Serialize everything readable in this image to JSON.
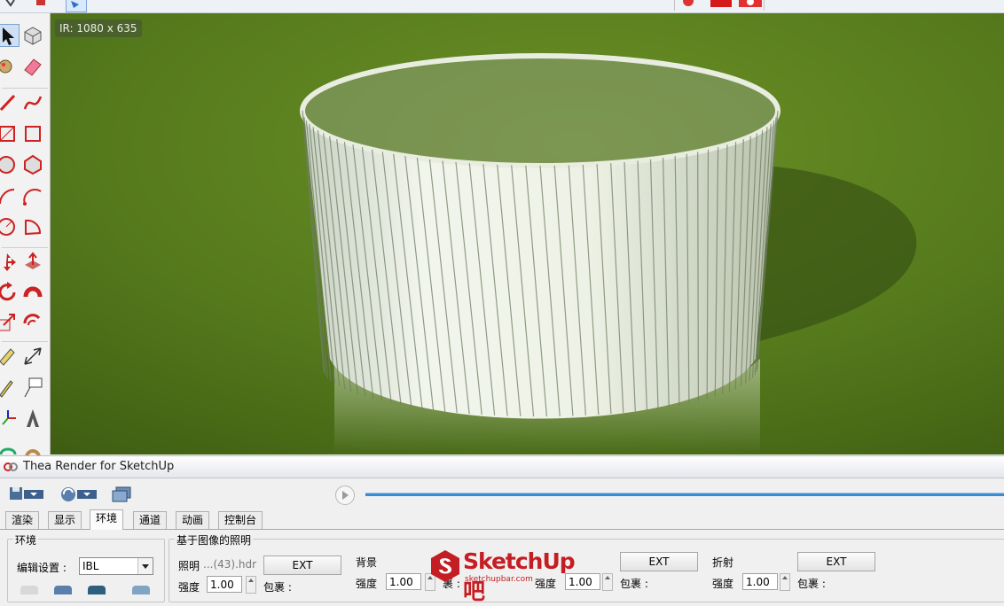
{
  "viewport": {
    "badge": "IR: 1080 x 635"
  },
  "thea": {
    "title": "Thea Render for SketchUp",
    "tabs": [
      "渲染",
      "显示",
      "环境",
      "通道",
      "动画",
      "控制台"
    ],
    "active_tab": "环境",
    "env_group": {
      "title": "环境",
      "edit_label": "编辑设置 :",
      "edit_value": "IBL"
    },
    "ibl_group": {
      "title": "基于图像的照明",
      "illum_label": "照明",
      "illum_file": "...(43).hdr",
      "ext_label": "EXT",
      "strength_label": "强度",
      "strength_value": "1.00",
      "wrap_label": "包裹 :"
    },
    "background": {
      "title": "背景",
      "strength_label": "强度",
      "strength_value": "1.00",
      "wrap_label_partial": "裹 :"
    },
    "reflection": {
      "ext_label": "EXT",
      "strength_label": "强度",
      "strength_value": "1.00",
      "wrap_label": "包裹 :"
    },
    "refraction": {
      "title": "折射",
      "ext_label": "EXT",
      "strength_label": "强度",
      "strength_value": "1.00",
      "wrap_label": "包裹 :"
    }
  },
  "watermark": {
    "brand": "SketchUp吧",
    "url": "sketchupbar.com"
  },
  "colors": {
    "grass": "#557a1c",
    "progress": "#3a8ad6",
    "watermark": "#c51d24"
  }
}
